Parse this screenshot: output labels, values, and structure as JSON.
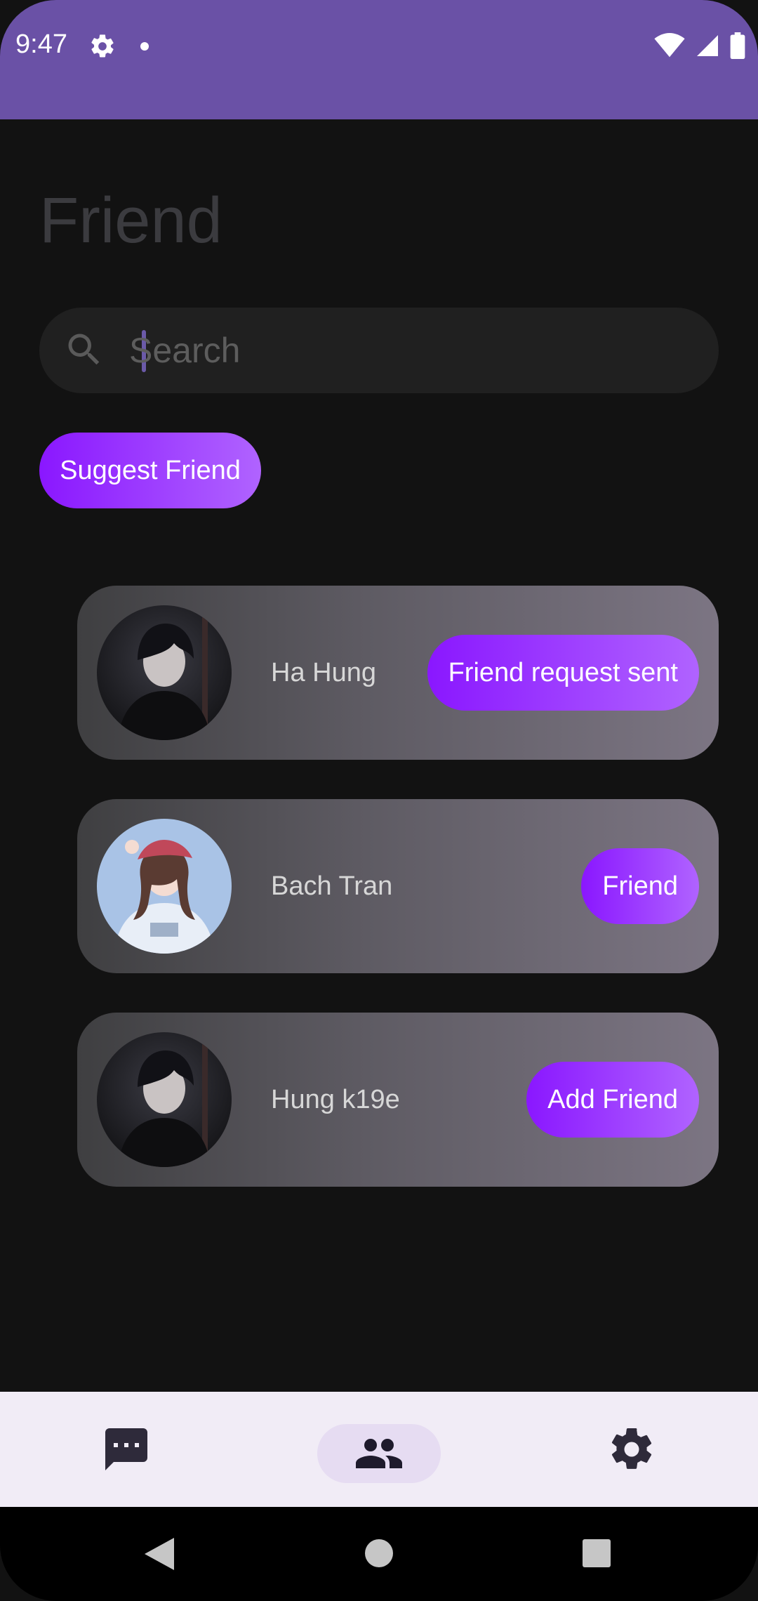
{
  "status_bar": {
    "time": "9:47",
    "icons": [
      "settings-icon",
      "notification-dot-icon",
      "wifi-icon",
      "signal-icon",
      "battery-icon"
    ]
  },
  "page": {
    "title": "Friend"
  },
  "search": {
    "placeholder": "Search",
    "value": ""
  },
  "suggest_button": {
    "label": "Suggest Friend"
  },
  "friends": [
    {
      "name": "Ha Hung",
      "action_label": "Friend request sent",
      "avatar": "dark-haired-boy-avatar"
    },
    {
      "name": "Bach Tran",
      "action_label": "Friend",
      "avatar": "girl-with-cap-avatar"
    },
    {
      "name": "Hung k19e",
      "action_label": "Add Friend",
      "avatar": "dark-haired-boy-avatar"
    }
  ],
  "bottom_nav": {
    "items": [
      {
        "icon": "chat-icon",
        "selected": false
      },
      {
        "icon": "people-icon",
        "selected": true
      },
      {
        "icon": "settings-icon",
        "selected": false
      }
    ]
  },
  "colors": {
    "status_bar": "#6a51a6",
    "accent_start": "#8a17ff",
    "accent_end": "#b063ff",
    "background": "#121212",
    "nav_background": "#f1ecf6"
  }
}
